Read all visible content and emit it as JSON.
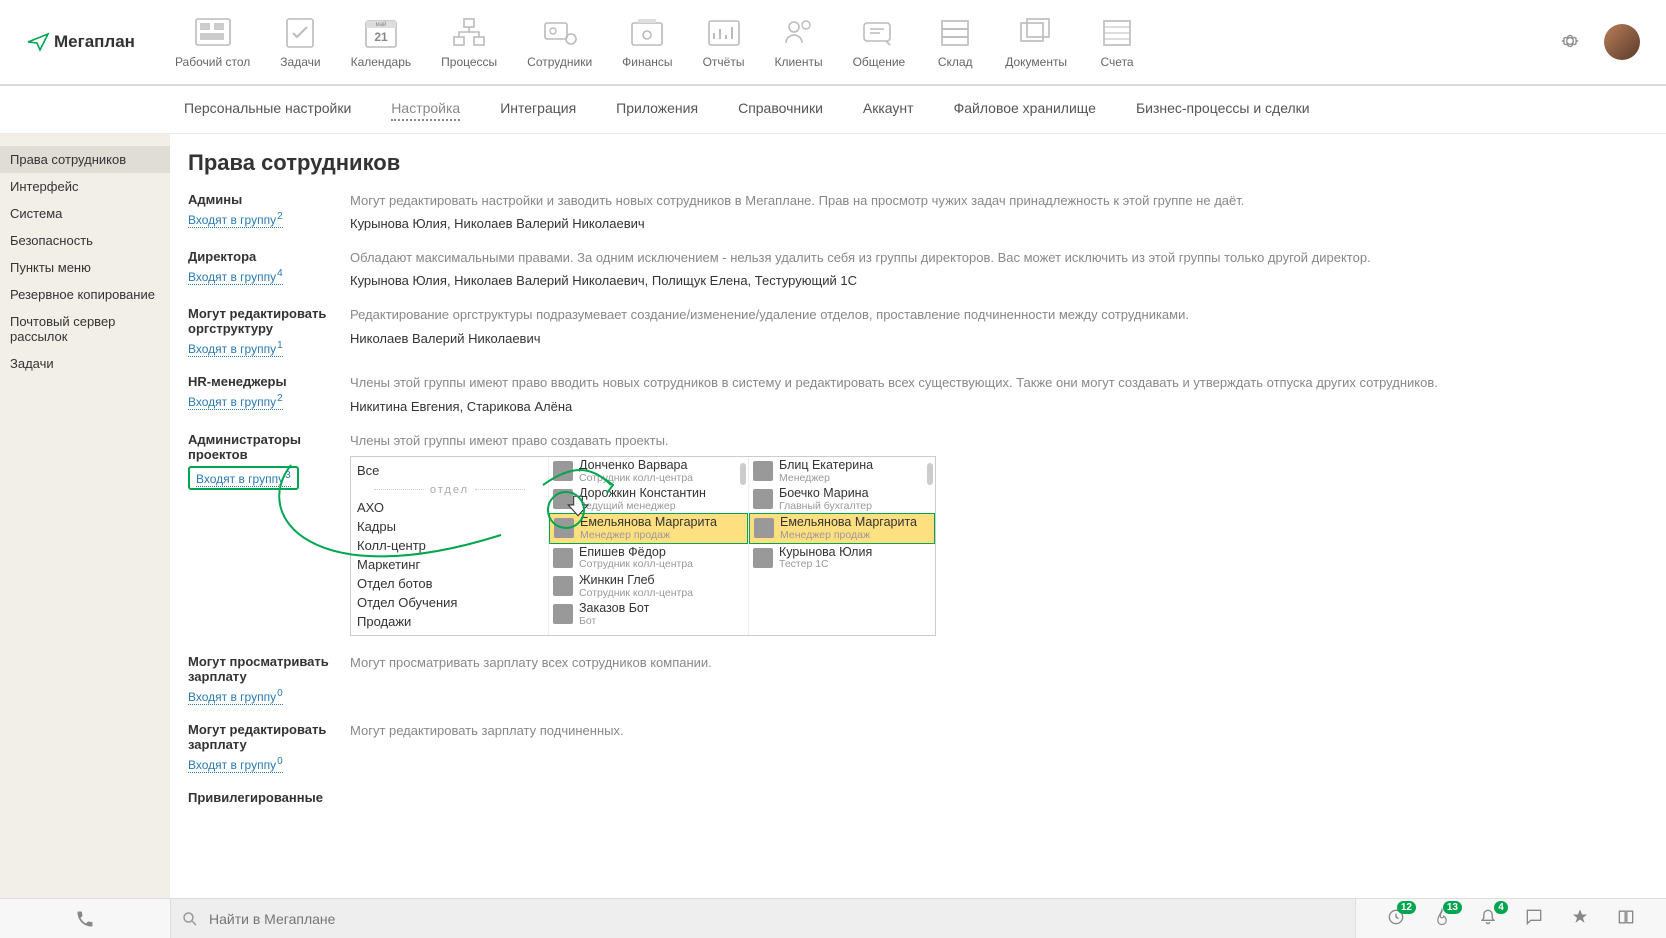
{
  "app": {
    "name": "Мегаплан"
  },
  "topnav": {
    "items": [
      "Рабочий стол",
      "Задачи",
      "Календарь",
      "Процессы",
      "Сотрудники",
      "Финансы",
      "Отчёты",
      "Клиенты",
      "Общение",
      "Склад",
      "Документы",
      "Счета"
    ],
    "calendar_month": "май",
    "calendar_day": "21"
  },
  "subnav": {
    "items": [
      "Персональные настройки",
      "Настройка",
      "Интеграция",
      "Приложения",
      "Справочники",
      "Аккаунт",
      "Файловое хранилище",
      "Бизнес-процессы и сделки"
    ],
    "active_index": 1
  },
  "sidebar": {
    "items": [
      "Права сотрудников",
      "Интерфейс",
      "Система",
      "Безопасность",
      "Пункты меню",
      "Резервное копирование",
      "Почтовый сервер рассылок",
      "Задачи"
    ],
    "active_index": 0
  },
  "page": {
    "title": "Права сотрудников",
    "link_label": "Входят в группу",
    "groups": [
      {
        "title": "Админы",
        "count": "2",
        "desc": "Могут редактировать настройки и заводить новых сотрудников в Мегаплане. Прав на просмотр чужих задач принадлежность к этой группе не даёт.",
        "members": "Курынова Юлия, Николаев Валерий Николаевич"
      },
      {
        "title": "Директора",
        "count": "4",
        "desc": "Обладают максимальными правами. За одним исключением - нельзя удалить себя из группы директоров. Вас может исключить из этой группы только другой директор.",
        "members": "Курынова Юлия, Николаев Валерий Николаевич, Полищук Елена, Тестурующий 1С"
      },
      {
        "title": "Могут редактировать оргструктуру",
        "count": "1",
        "desc": "Редактирование оргструктуры подразумевает создание/изменение/удаление отделов, проставление подчиненности между сотрудниками.",
        "members": "Николаев Валерий Николаевич"
      },
      {
        "title": "HR-менеджеры",
        "count": "2",
        "desc": "Члены этой группы имеют право вводить новых сотрудников в систему и редактировать всех существующих. Также они могут создавать и утверждать отпуска других сотрудников.",
        "members": "Никитина Евгения, Старикова Алёна"
      },
      {
        "title": "Администраторы проектов",
        "count": "3",
        "desc": "Члены этой группы имеют право создавать проекты.",
        "members": ""
      },
      {
        "title": "Могут просматривать зарплату",
        "count": "0",
        "desc": "Могут просматривать зарплату всех сотрудников компании.",
        "members": ""
      },
      {
        "title": "Могут редактировать зарплату",
        "count": "0",
        "desc": "Могут редактировать зарплату подчиненных.",
        "members": ""
      },
      {
        "title": "Привилегированные",
        "count": "",
        "desc": "",
        "members": ""
      }
    ]
  },
  "picker": {
    "all_label": "Все",
    "dept_label": "отдел",
    "depts": [
      "АХО",
      "Кадры",
      "Колл-центр",
      "Маркетинг",
      "Отдел ботов",
      "Отдел Обучения",
      "Продажи"
    ],
    "source": [
      {
        "name": "Донченко Варвара",
        "role": "Сотрудник колл-центра"
      },
      {
        "name": "Дорожкин Константин",
        "role": "Ведущий менеджер"
      },
      {
        "name": "Емельянова Маргарита",
        "role": "Менеджер продаж",
        "hl": true
      },
      {
        "name": "Епишев Фёдор",
        "role": "Сотрудник колл-центра"
      },
      {
        "name": "Жинкин Глеб",
        "role": "Сотрудник колл-центра"
      },
      {
        "name": "Заказов Бот",
        "role": "Бот"
      }
    ],
    "target": [
      {
        "name": "Блиц Екатерина",
        "role": "Менеджер"
      },
      {
        "name": "Боечко Марина",
        "role": "Главный бухгалтер"
      },
      {
        "name": "Емельянова Маргарита",
        "role": "Менеджер продаж",
        "hl": true
      },
      {
        "name": "Курынова Юлия",
        "role": "Тестер 1С"
      }
    ]
  },
  "footer": {
    "search_placeholder": "Найти в Мегаплане",
    "badges": {
      "clock": "12",
      "fire": "13",
      "bell": "4"
    }
  }
}
